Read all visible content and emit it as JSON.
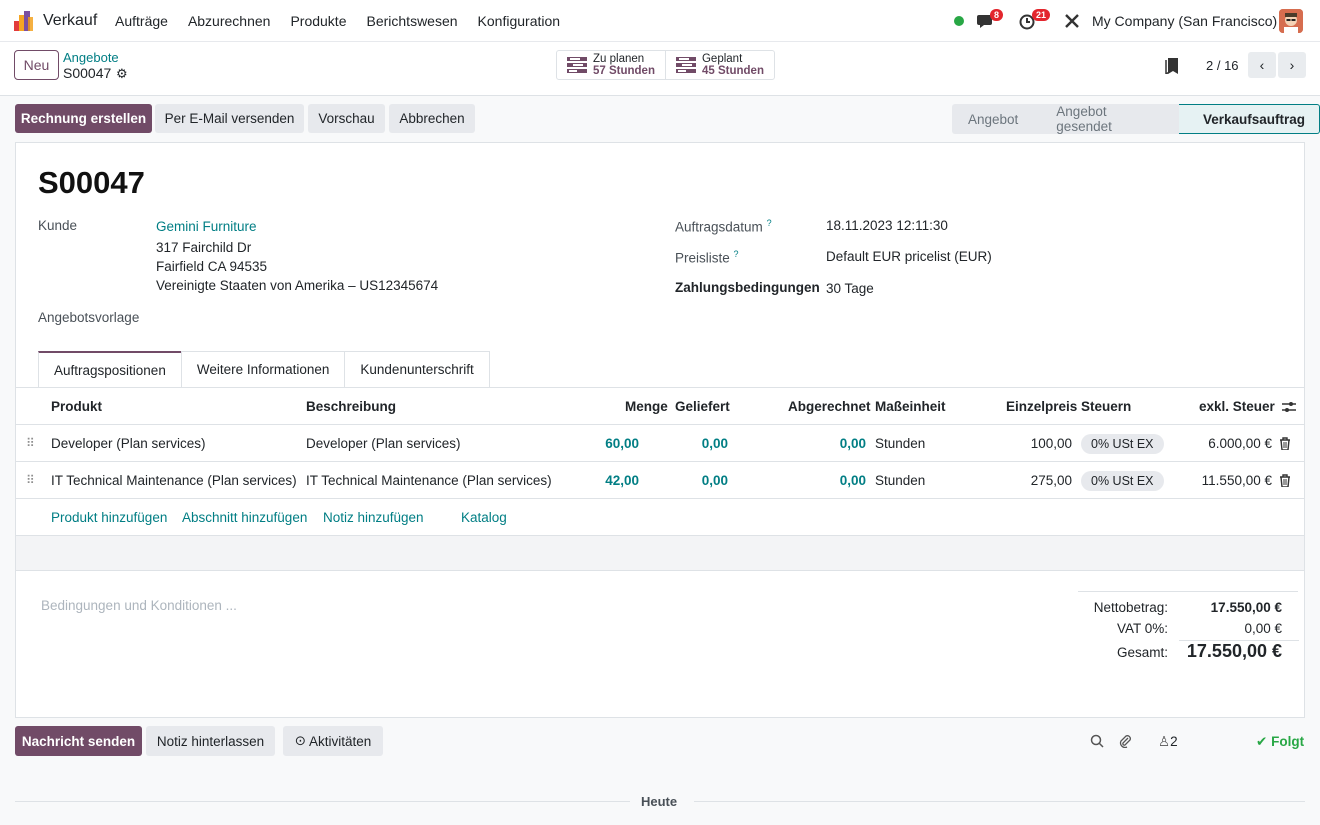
{
  "navbar": {
    "app_name": "Verkauf",
    "menu": [
      "Aufträge",
      "Abzurechnen",
      "Produkte",
      "Berichtswesen",
      "Konfiguration"
    ],
    "messages_badge": "8",
    "activities_badge": "21",
    "company": "My Company (San Francisco)"
  },
  "control": {
    "new_label": "Neu",
    "breadcrumb_parent": "Angebote",
    "breadcrumb_current": "S00047",
    "smart_buttons": [
      {
        "label": "Zu planen",
        "value": "57 Stunden"
      },
      {
        "label": "Geplant",
        "value": "45 Stunden"
      }
    ],
    "pager": "2 / 16"
  },
  "actions": {
    "create_invoice": "Rechnung erstellen",
    "send_email": "Per E-Mail versenden",
    "preview": "Vorschau",
    "cancel": "Abbrechen"
  },
  "status": {
    "stages": [
      "Angebot",
      "Angebot gesendet",
      "Verkaufsauftrag"
    ],
    "active": "Verkaufsauftrag"
  },
  "form": {
    "title": "S00047",
    "customer_label": "Kunde",
    "customer_name": "Gemini Furniture",
    "address_line1": "317 Fairchild Dr",
    "address_line2": "Fairfield CA 94535",
    "address_line3": "Vereinigte Staaten von Amerika – US12345674",
    "template_label": "Angebotsvorlage",
    "order_date_label": "Auftragsdatum",
    "order_date": "18.11.2023 12:11:30",
    "pricelist_label": "Preisliste",
    "pricelist": "Default EUR pricelist (EUR)",
    "payment_terms_label": "Zahlungsbedingungen",
    "payment_terms": "30 Tage",
    "help_mark": "?"
  },
  "tabs": [
    "Auftragspositionen",
    "Weitere Informationen",
    "Kundenunterschrift"
  ],
  "table": {
    "headers": {
      "product": "Produkt",
      "description": "Beschreibung",
      "qty": "Menge",
      "delivered": "Geliefert",
      "invoiced": "Abgerechnet",
      "uom": "Maßeinheit",
      "price": "Einzelpreis",
      "taxes": "Steuern",
      "subtotal": "exkl. Steuer"
    },
    "rows": [
      {
        "product": "Developer (Plan services)",
        "description": "Developer (Plan services)",
        "qty": "60,00",
        "delivered": "0,00",
        "invoiced": "0,00",
        "uom": "Stunden",
        "price": "100,00",
        "tax": "0% USt EX",
        "subtotal": "6.000,00 €"
      },
      {
        "product": "IT Technical Maintenance (Plan services)",
        "description": "IT Technical Maintenance (Plan services)",
        "qty": "42,00",
        "delivered": "0,00",
        "invoiced": "0,00",
        "uom": "Stunden",
        "price": "275,00",
        "tax": "0% USt EX",
        "subtotal": "11.550,00 €"
      }
    ],
    "add_product": "Produkt hinzufügen",
    "add_section": "Abschnitt hinzufügen",
    "add_note": "Notiz hinzufügen",
    "catalog": "Katalog"
  },
  "footer": {
    "terms_placeholder": "Bedingungen und Konditionen ...",
    "net_label": "Nettobetrag:",
    "net_value": "17.550,00 €",
    "vat_label": "VAT 0%:",
    "vat_value": "0,00 €",
    "total_label": "Gesamt:",
    "total_value": "17.550,00 €"
  },
  "chatter": {
    "send_message": "Nachricht senden",
    "log_note": "Notiz hinterlassen",
    "activities": "Aktivitäten",
    "followers_count": "2",
    "follow": "Folgt",
    "today": "Heute"
  },
  "colors": {
    "brand": "#714b67",
    "link": "#017e84",
    "success": "#28a745",
    "badge": "#e3262d"
  }
}
